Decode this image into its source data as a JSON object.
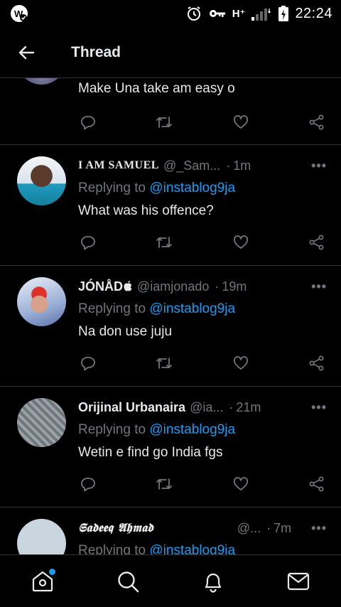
{
  "status_bar": {
    "time": "22:24",
    "network": "H⁺",
    "icons": [
      "app-w-icon",
      "alarm-icon",
      "key-icon",
      "signal-icon",
      "battery-charging-icon"
    ]
  },
  "header": {
    "title": "Thread",
    "back_icon": "arrow-left-icon"
  },
  "tweets": [
    {
      "text": "Make Una take am easy o"
    },
    {
      "name": "I AM SAMUEL",
      "handle": "@_Sam...",
      "time": "1m",
      "replying_prefix": "Replying to",
      "replying_user": "@instablog9ja",
      "text": "What was his offence?"
    },
    {
      "name": "JÓNÅD",
      "handle": "@iamjonado",
      "time": "19m",
      "replying_prefix": "Replying to",
      "replying_user": "@instablog9ja",
      "text": "Na don use juju"
    },
    {
      "name": "Orijinal Urbanaira",
      "handle": "@ia...",
      "time": "21m",
      "replying_prefix": "Replying to",
      "replying_user": "@instablog9ja",
      "text": "Wetin e find go India fgs"
    },
    {
      "name": "𝕾𝖆𝖉𝖊𝖊𝖖 𝕬𝖍𝖒𝖆𝖉",
      "handle": "@...",
      "time": "7m",
      "replying_prefix": "Replying to",
      "replying_user": "@instablog9ja"
    }
  ],
  "separator": "·",
  "more": "•••",
  "bottom_nav": [
    "home-icon",
    "search-icon",
    "notifications-icon",
    "messages-icon"
  ],
  "colors": {
    "accent": "#1d9bf0",
    "muted": "#71767b",
    "divider": "#2f3336"
  }
}
